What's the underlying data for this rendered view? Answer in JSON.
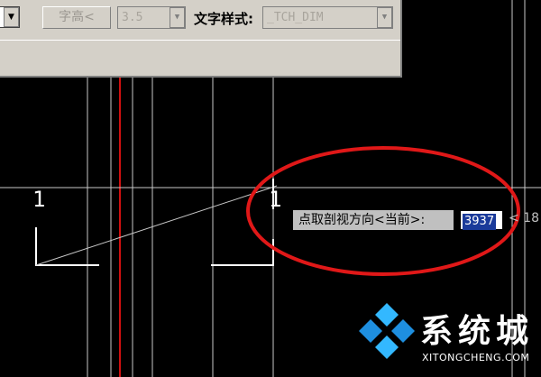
{
  "toolbar": {
    "text_height_button": "字高<",
    "height_value": "3.5",
    "text_style_label": "文字样式:",
    "text_style_value": "_TCH_DIM"
  },
  "drawing": {
    "section_number_left": "1",
    "section_number_right": "1"
  },
  "command_line": {
    "prompt": "点取剖视方向<当前>:",
    "input_value": "3937",
    "extra_text": "< 18"
  },
  "watermark": {
    "chinese": "系统城",
    "domain": "XITONGCHENG.COM"
  },
  "colors": {
    "background": "#000000",
    "grid_line": "#c8c8c8",
    "axis_line": "#d01010",
    "highlight_ellipse": "#e01818",
    "watermark_blue": "#1e8fe0"
  }
}
